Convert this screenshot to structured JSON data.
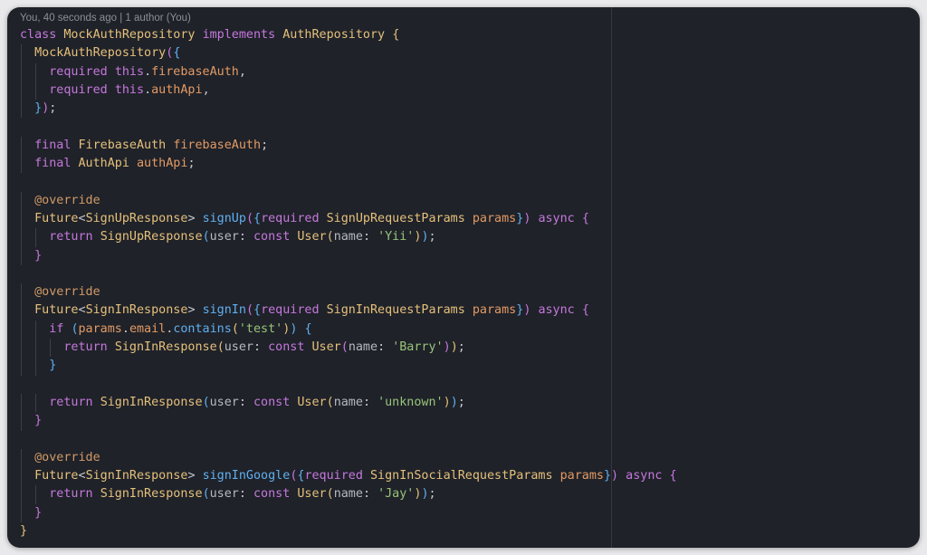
{
  "blame": "You, 40 seconds ago | 1 author (You)",
  "code_lines": [
    {
      "indent": 0,
      "tokens": [
        {
          "t": "class ",
          "c": "kw"
        },
        {
          "t": "MockAuthRepository ",
          "c": "ty"
        },
        {
          "t": "implements ",
          "c": "kw"
        },
        {
          "t": "AuthRepository ",
          "c": "ty"
        },
        {
          "t": "{",
          "c": "b1"
        }
      ]
    },
    {
      "indent": 1,
      "tokens": [
        {
          "t": "MockAuthRepository",
          "c": "ty"
        },
        {
          "t": "(",
          "c": "b2"
        },
        {
          "t": "{",
          "c": "b3"
        }
      ]
    },
    {
      "indent": 2,
      "tokens": [
        {
          "t": "required ",
          "c": "kw"
        },
        {
          "t": "this",
          "c": "kw"
        },
        {
          "t": ".",
          "c": "pl"
        },
        {
          "t": "firebaseAuth",
          "c": "pr"
        },
        {
          "t": ",",
          "c": "pl"
        }
      ]
    },
    {
      "indent": 2,
      "tokens": [
        {
          "t": "required ",
          "c": "kw"
        },
        {
          "t": "this",
          "c": "kw"
        },
        {
          "t": ".",
          "c": "pl"
        },
        {
          "t": "authApi",
          "c": "pr"
        },
        {
          "t": ",",
          "c": "pl"
        }
      ]
    },
    {
      "indent": 1,
      "tokens": [
        {
          "t": "}",
          "c": "b3"
        },
        {
          "t": ")",
          "c": "b2"
        },
        {
          "t": ";",
          "c": "pl"
        }
      ]
    },
    {
      "indent": 0,
      "tokens": []
    },
    {
      "indent": 1,
      "tokens": [
        {
          "t": "final ",
          "c": "kw"
        },
        {
          "t": "FirebaseAuth ",
          "c": "ty"
        },
        {
          "t": "firebaseAuth",
          "c": "pr"
        },
        {
          "t": ";",
          "c": "pl"
        }
      ]
    },
    {
      "indent": 1,
      "tokens": [
        {
          "t": "final ",
          "c": "kw"
        },
        {
          "t": "AuthApi ",
          "c": "ty"
        },
        {
          "t": "authApi",
          "c": "pr"
        },
        {
          "t": ";",
          "c": "pl"
        }
      ]
    },
    {
      "indent": 0,
      "tokens": []
    },
    {
      "indent": 1,
      "tokens": [
        {
          "t": "@override",
          "c": "an"
        }
      ]
    },
    {
      "indent": 1,
      "tokens": [
        {
          "t": "Future",
          "c": "ty"
        },
        {
          "t": "<",
          "c": "pl"
        },
        {
          "t": "SignUpResponse",
          "c": "ty"
        },
        {
          "t": "> ",
          "c": "pl"
        },
        {
          "t": "signUp",
          "c": "fn"
        },
        {
          "t": "(",
          "c": "b2"
        },
        {
          "t": "{",
          "c": "b3"
        },
        {
          "t": "required ",
          "c": "kw"
        },
        {
          "t": "SignUpRequestParams ",
          "c": "ty"
        },
        {
          "t": "params",
          "c": "pr"
        },
        {
          "t": "}",
          "c": "b3"
        },
        {
          "t": ") ",
          "c": "b2"
        },
        {
          "t": "async ",
          "c": "kw"
        },
        {
          "t": "{",
          "c": "b2"
        }
      ]
    },
    {
      "indent": 2,
      "tokens": [
        {
          "t": "return ",
          "c": "kw"
        },
        {
          "t": "SignUpResponse",
          "c": "ty"
        },
        {
          "t": "(",
          "c": "b3"
        },
        {
          "t": "user",
          "c": "nm"
        },
        {
          "t": ": ",
          "c": "pl"
        },
        {
          "t": "const ",
          "c": "kw"
        },
        {
          "t": "User",
          "c": "ty"
        },
        {
          "t": "(",
          "c": "b1"
        },
        {
          "t": "name",
          "c": "nm"
        },
        {
          "t": ": ",
          "c": "pl"
        },
        {
          "t": "'Yii'",
          "c": "st"
        },
        {
          "t": ")",
          "c": "b1"
        },
        {
          "t": ")",
          "c": "b3"
        },
        {
          "t": ";",
          "c": "pl"
        }
      ]
    },
    {
      "indent": 1,
      "tokens": [
        {
          "t": "}",
          "c": "b2"
        }
      ]
    },
    {
      "indent": 0,
      "tokens": []
    },
    {
      "indent": 1,
      "tokens": [
        {
          "t": "@override",
          "c": "an"
        }
      ]
    },
    {
      "indent": 1,
      "tokens": [
        {
          "t": "Future",
          "c": "ty"
        },
        {
          "t": "<",
          "c": "pl"
        },
        {
          "t": "SignInResponse",
          "c": "ty"
        },
        {
          "t": "> ",
          "c": "pl"
        },
        {
          "t": "signIn",
          "c": "fn"
        },
        {
          "t": "(",
          "c": "b2"
        },
        {
          "t": "{",
          "c": "b3"
        },
        {
          "t": "required ",
          "c": "kw"
        },
        {
          "t": "SignInRequestParams ",
          "c": "ty"
        },
        {
          "t": "params",
          "c": "pr"
        },
        {
          "t": "}",
          "c": "b3"
        },
        {
          "t": ") ",
          "c": "b2"
        },
        {
          "t": "async ",
          "c": "kw"
        },
        {
          "t": "{",
          "c": "b2"
        }
      ]
    },
    {
      "indent": 2,
      "tokens": [
        {
          "t": "if ",
          "c": "kw"
        },
        {
          "t": "(",
          "c": "b3"
        },
        {
          "t": "params",
          "c": "pr"
        },
        {
          "t": ".",
          "c": "pl"
        },
        {
          "t": "email",
          "c": "pr"
        },
        {
          "t": ".",
          "c": "pl"
        },
        {
          "t": "contains",
          "c": "fn"
        },
        {
          "t": "(",
          "c": "b1"
        },
        {
          "t": "'test'",
          "c": "st"
        },
        {
          "t": ")",
          "c": "b1"
        },
        {
          "t": ") ",
          "c": "b3"
        },
        {
          "t": "{",
          "c": "b3"
        }
      ]
    },
    {
      "indent": 3,
      "tokens": [
        {
          "t": "return ",
          "c": "kw"
        },
        {
          "t": "SignInResponse",
          "c": "ty"
        },
        {
          "t": "(",
          "c": "b1"
        },
        {
          "t": "user",
          "c": "nm"
        },
        {
          "t": ": ",
          "c": "pl"
        },
        {
          "t": "const ",
          "c": "kw"
        },
        {
          "t": "User",
          "c": "ty"
        },
        {
          "t": "(",
          "c": "b2"
        },
        {
          "t": "name",
          "c": "nm"
        },
        {
          "t": ": ",
          "c": "pl"
        },
        {
          "t": "'Barry'",
          "c": "st"
        },
        {
          "t": ")",
          "c": "b2"
        },
        {
          "t": ")",
          "c": "b1"
        },
        {
          "t": ";",
          "c": "pl"
        }
      ]
    },
    {
      "indent": 2,
      "tokens": [
        {
          "t": "}",
          "c": "b3"
        }
      ]
    },
    {
      "indent": 0,
      "tokens": []
    },
    {
      "indent": 2,
      "tokens": [
        {
          "t": "return ",
          "c": "kw"
        },
        {
          "t": "SignInResponse",
          "c": "ty"
        },
        {
          "t": "(",
          "c": "b3"
        },
        {
          "t": "user",
          "c": "nm"
        },
        {
          "t": ": ",
          "c": "pl"
        },
        {
          "t": "const ",
          "c": "kw"
        },
        {
          "t": "User",
          "c": "ty"
        },
        {
          "t": "(",
          "c": "b1"
        },
        {
          "t": "name",
          "c": "nm"
        },
        {
          "t": ": ",
          "c": "pl"
        },
        {
          "t": "'unknown'",
          "c": "st"
        },
        {
          "t": ")",
          "c": "b1"
        },
        {
          "t": ")",
          "c": "b3"
        },
        {
          "t": ";",
          "c": "pl"
        }
      ]
    },
    {
      "indent": 1,
      "tokens": [
        {
          "t": "}",
          "c": "b2"
        }
      ]
    },
    {
      "indent": 0,
      "tokens": []
    },
    {
      "indent": 1,
      "tokens": [
        {
          "t": "@override",
          "c": "an"
        }
      ]
    },
    {
      "indent": 1,
      "tokens": [
        {
          "t": "Future",
          "c": "ty"
        },
        {
          "t": "<",
          "c": "pl"
        },
        {
          "t": "SignInResponse",
          "c": "ty"
        },
        {
          "t": "> ",
          "c": "pl"
        },
        {
          "t": "signInGoogle",
          "c": "fn"
        },
        {
          "t": "(",
          "c": "b2"
        },
        {
          "t": "{",
          "c": "b3"
        },
        {
          "t": "required ",
          "c": "kw"
        },
        {
          "t": "SignInSocialRequestParams ",
          "c": "ty"
        },
        {
          "t": "params",
          "c": "pr"
        },
        {
          "t": "}",
          "c": "b3"
        },
        {
          "t": ") ",
          "c": "b2"
        },
        {
          "t": "async ",
          "c": "kw"
        },
        {
          "t": "{",
          "c": "b2"
        }
      ]
    },
    {
      "indent": 2,
      "tokens": [
        {
          "t": "return ",
          "c": "kw"
        },
        {
          "t": "SignInResponse",
          "c": "ty"
        },
        {
          "t": "(",
          "c": "b3"
        },
        {
          "t": "user",
          "c": "nm"
        },
        {
          "t": ": ",
          "c": "pl"
        },
        {
          "t": "const ",
          "c": "kw"
        },
        {
          "t": "User",
          "c": "ty"
        },
        {
          "t": "(",
          "c": "b1"
        },
        {
          "t": "name",
          "c": "nm"
        },
        {
          "t": ": ",
          "c": "pl"
        },
        {
          "t": "'Jay'",
          "c": "st"
        },
        {
          "t": ")",
          "c": "b1"
        },
        {
          "t": ")",
          "c": "b3"
        },
        {
          "t": ";",
          "c": "pl"
        }
      ]
    },
    {
      "indent": 1,
      "tokens": [
        {
          "t": "}",
          "c": "b2"
        }
      ]
    },
    {
      "indent": 0,
      "tokens": [
        {
          "t": "}",
          "c": "b1"
        }
      ]
    }
  ],
  "colors": {
    "background": "#1f2229",
    "keyword": "#c678dd",
    "type": "#e5c07b",
    "function": "#61afef",
    "property": "#e39a64",
    "string": "#98c379",
    "annotation": "#d19a66"
  }
}
